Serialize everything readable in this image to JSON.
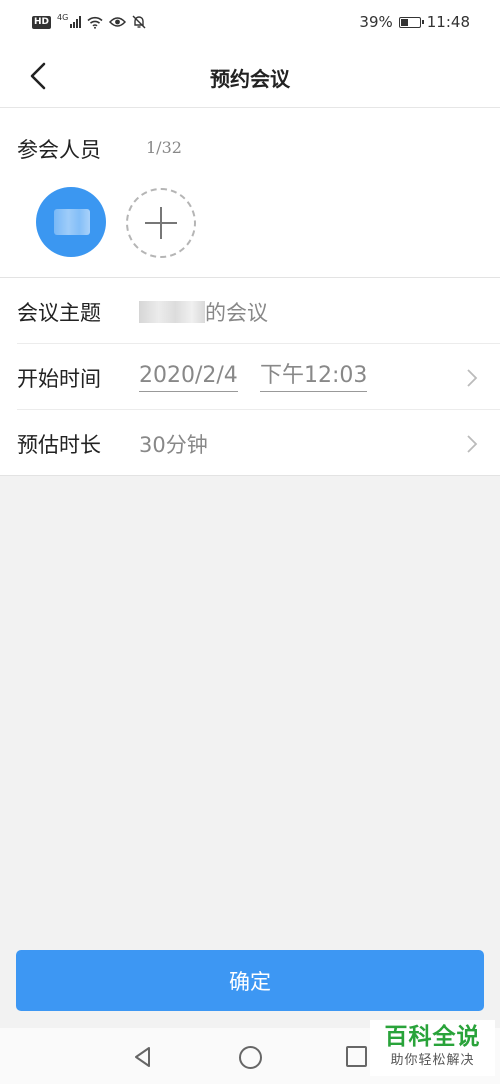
{
  "status_bar": {
    "hd_badge": "HD",
    "network": "4G",
    "battery_text": "39%",
    "battery_level": 0.39,
    "time": "11:48",
    "icons": [
      "hd-icon",
      "signal-icon",
      "wifi-icon",
      "eye-icon",
      "bell-off-icon",
      "battery-icon"
    ]
  },
  "nav_bar": {
    "title": "预约会议",
    "back_icon": "chevron-left-icon"
  },
  "attendees": {
    "label": "参会人员",
    "count": "1/32",
    "add_icon": "plus-icon"
  },
  "form": {
    "subject": {
      "label": "会议主题",
      "value_suffix": "的会议"
    },
    "start_time": {
      "label": "开始时间",
      "date": "2020/2/4",
      "time": "下午12:03"
    },
    "duration": {
      "label": "预估时长",
      "value": "30分钟"
    }
  },
  "confirm_button": {
    "label": "确定"
  },
  "system_nav": {
    "icons": [
      "back-triangle-icon",
      "home-circle-icon",
      "recents-square-icon"
    ]
  },
  "watermark": {
    "title": "百科全说",
    "subtitle": "助你轻松解决"
  },
  "colors": {
    "accent": "#3d97f3",
    "watermark_green": "#29a33a",
    "background": "#f2f2f2"
  }
}
